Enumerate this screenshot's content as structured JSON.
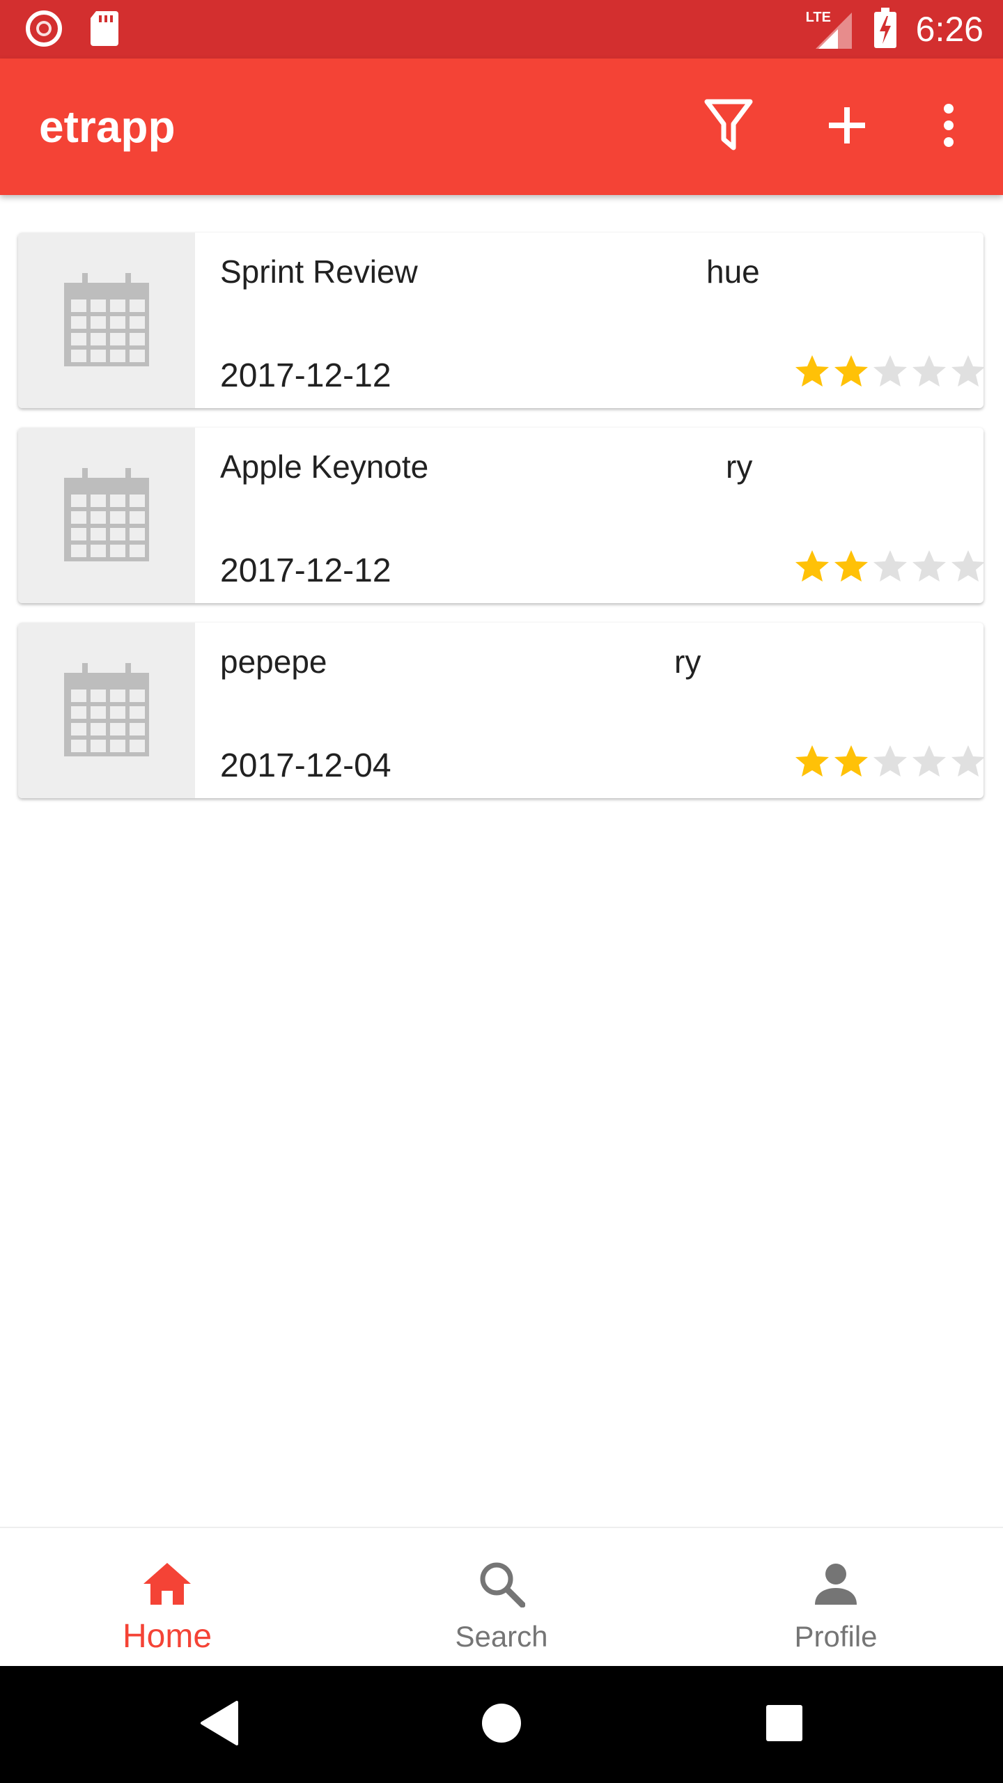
{
  "status_bar": {
    "time": "6:26",
    "network": "LTE",
    "icons": [
      "record-icon",
      "sd-card-icon",
      "signal-icon",
      "battery-charging-icon"
    ]
  },
  "app_bar": {
    "title": "etrapp",
    "actions": [
      {
        "name": "filter",
        "icon": "filter-icon"
      },
      {
        "name": "add",
        "icon": "plus-icon"
      },
      {
        "name": "more",
        "icon": "more-vert-icon"
      }
    ]
  },
  "events": [
    {
      "title": "Sprint Review",
      "extra": "hue",
      "date": "2017-12-12",
      "rating": 2,
      "max_rating": 5
    },
    {
      "title": "Apple Keynote",
      "extra": "ry",
      "date": "2017-12-12",
      "rating": 2,
      "max_rating": 5
    },
    {
      "title": "pepepe",
      "extra": "ry",
      "date": "2017-12-04",
      "rating": 2,
      "max_rating": 5
    }
  ],
  "bottom_nav": {
    "items": [
      {
        "label": "Home",
        "icon": "home-icon",
        "active": true
      },
      {
        "label": "Search",
        "icon": "search-icon",
        "active": false
      },
      {
        "label": "Profile",
        "icon": "person-icon",
        "active": false
      }
    ]
  },
  "colors": {
    "status_bar": "#d32f2f",
    "primary": "#f44336",
    "star_filled": "#ffc107",
    "star_empty": "#e0e0e0"
  }
}
